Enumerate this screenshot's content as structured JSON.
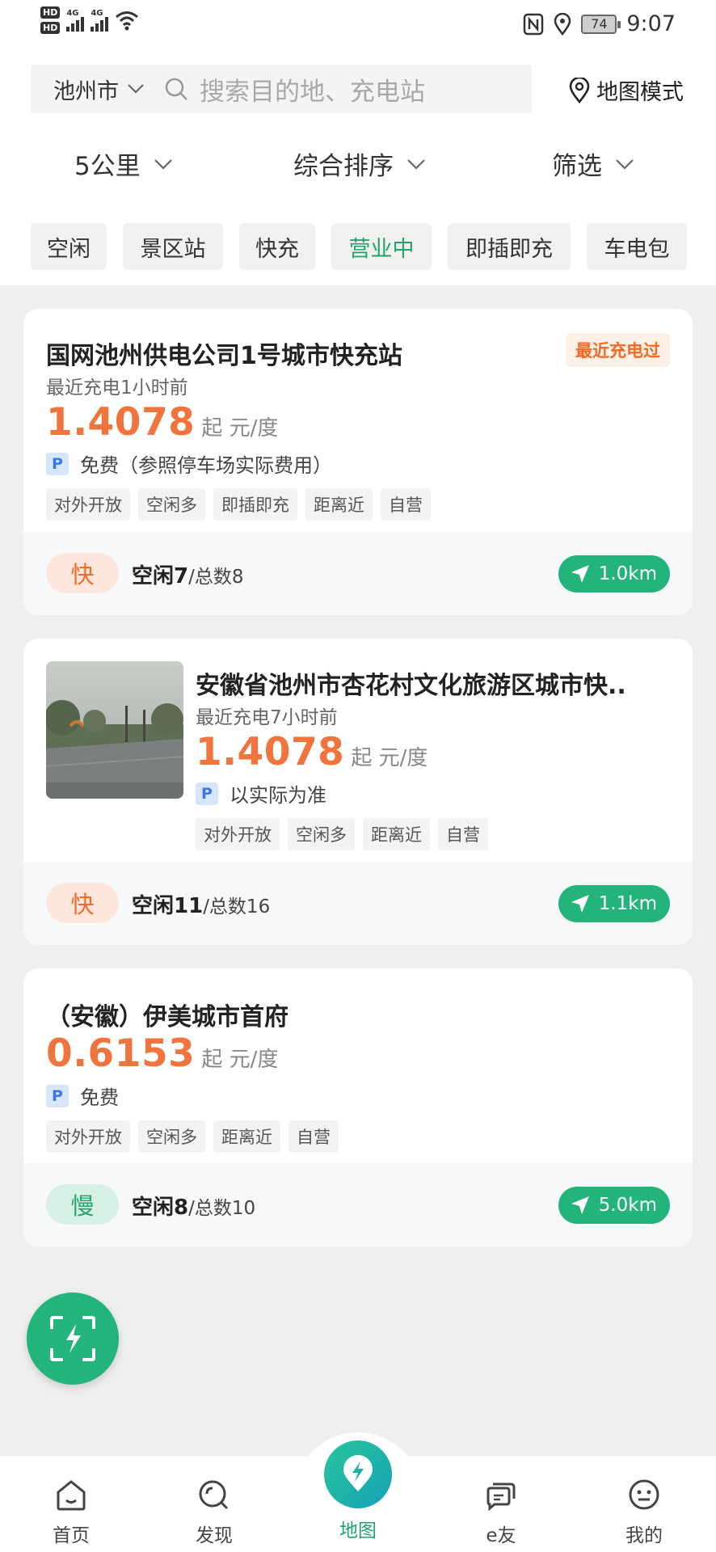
{
  "status_bar": {
    "hd1": "HD",
    "hd2": "HD",
    "net1": "4G",
    "net2": "4G",
    "battery": "74",
    "time": "9:07"
  },
  "search": {
    "city": "池州市",
    "placeholder": "搜索目的地、充电站",
    "map_mode": "地图模式"
  },
  "filters": {
    "distance": "5公里",
    "sort": "综合排序",
    "filter": "筛选"
  },
  "chips": [
    "空闲",
    "景区站",
    "快充",
    "营业中",
    "即插即充",
    "车电包"
  ],
  "chip_active_index": 3,
  "stations": [
    {
      "name": "国网池州供电公司1号城市快充站",
      "recent_badge": "最近充电过",
      "last_charge": "最近充电1小时前",
      "price": "1.4078",
      "price_unit": "起 元/度",
      "parking_icon": "P",
      "parking": "免费（参照停车场实际费用）",
      "tags": [
        "对外开放",
        "空闲多",
        "即插即充",
        "距离近",
        "自营"
      ],
      "speed": "快",
      "idle": "空闲7",
      "total": "/总数8",
      "distance": "1.0km"
    },
    {
      "name": "安徽省池州市杏花村文化旅游区城市快..",
      "last_charge": "最近充电7小时前",
      "price": "1.4078",
      "price_unit": "起 元/度",
      "parking_icon": "P",
      "parking": "以实际为准",
      "tags": [
        "对外开放",
        "空闲多",
        "距离近",
        "自营"
      ],
      "speed": "快",
      "idle": "空闲11",
      "total": "/总数16",
      "distance": "1.1km"
    },
    {
      "name": "（安徽）伊美城市首府",
      "price": "0.6153",
      "price_unit": "起 元/度",
      "parking_icon": "P",
      "parking": "免费",
      "tags": [
        "对外开放",
        "空闲多",
        "距离近",
        "自营"
      ],
      "speed": "慢",
      "idle": "空闲8",
      "total": "/总数10",
      "distance": "5.0km"
    }
  ],
  "tabs": [
    {
      "label": "首页",
      "icon": "home-icon"
    },
    {
      "label": "发现",
      "icon": "discover-icon"
    },
    {
      "label": "地图",
      "icon": "map-charge-icon"
    },
    {
      "label": "e友",
      "icon": "chat-icon"
    },
    {
      "label": "我的",
      "icon": "profile-icon"
    }
  ],
  "active_tab": 2,
  "colors": {
    "accent_green": "#22b47a",
    "price_orange": "#f0743d",
    "recent_orange": "#ef6b26"
  }
}
